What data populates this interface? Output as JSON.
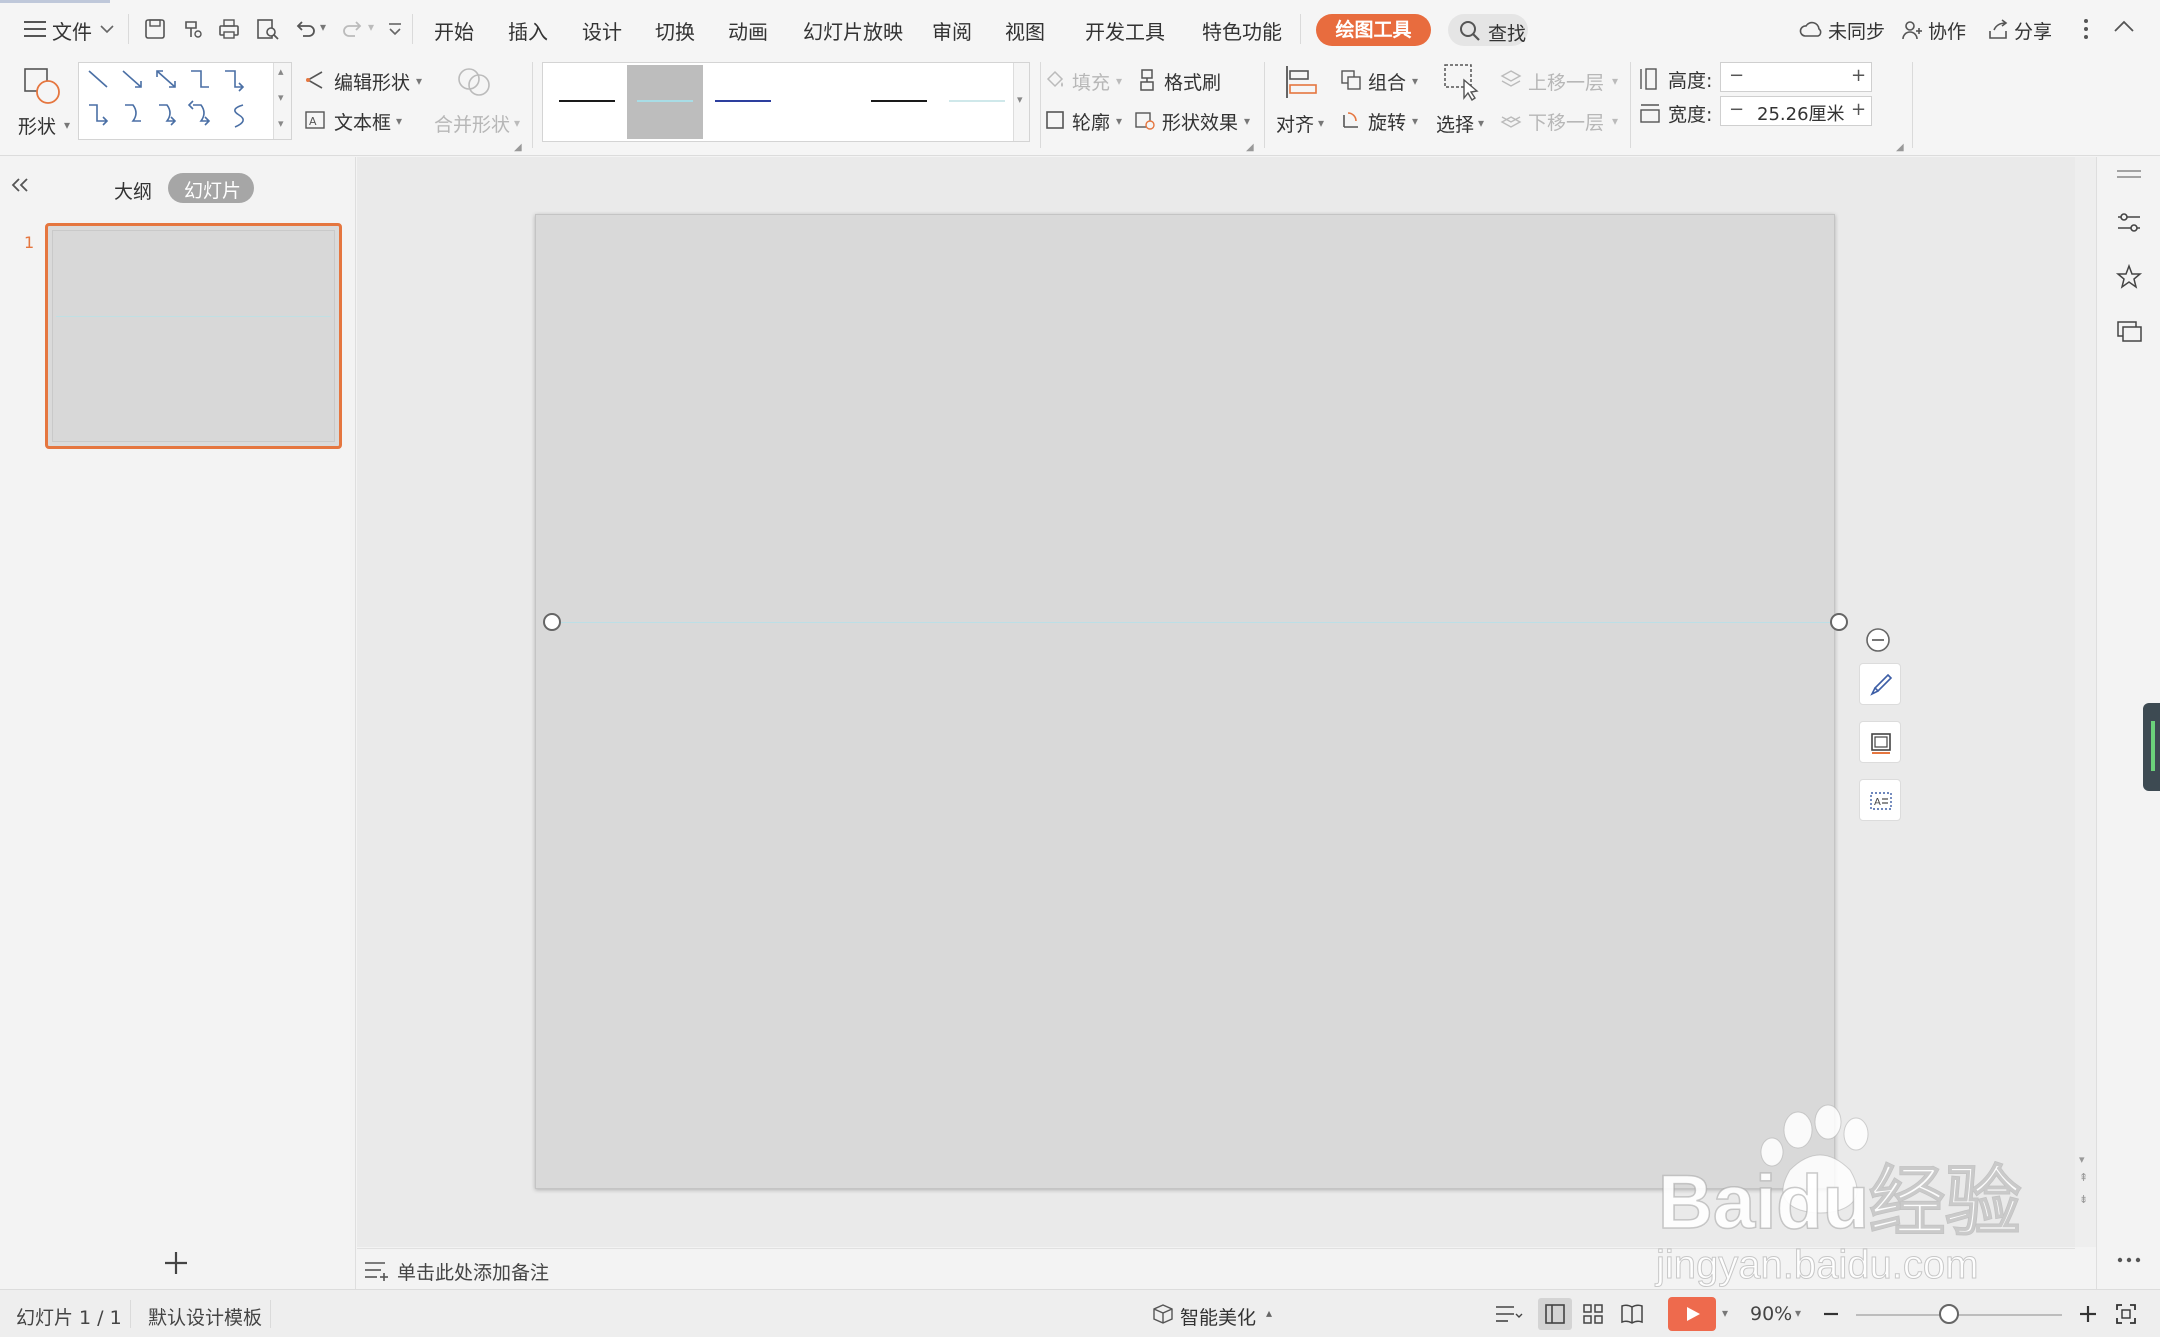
{
  "menu": {
    "file_label": "文件",
    "tabs": [
      "开始",
      "插入",
      "设计",
      "切换",
      "动画",
      "幻灯片放映",
      "审阅",
      "视图",
      "开发工具",
      "特色功能"
    ],
    "active_tab": "绘图工具",
    "search_label": "查找",
    "sync_label": "未同步",
    "collab_label": "协作",
    "share_label": "分享"
  },
  "ribbon": {
    "shape_label": "形状",
    "edit_shape_label": "编辑形状",
    "textbox_label": "文本框",
    "merge_shape_label": "合并形状",
    "fill_label": "填充",
    "format_painter_label": "格式刷",
    "outline_label": "轮廓",
    "shape_effect_label": "形状效果",
    "align_label": "对齐",
    "group_label": "组合",
    "rotate_label": "旋转",
    "select_label": "选择",
    "bring_forward_label": "上移一层",
    "send_backward_label": "下移一层",
    "height_label": "高度:",
    "height_value": "",
    "width_label": "宽度:",
    "width_value": "25.26厘米",
    "style_swatch_colors": [
      "#1a1a1a",
      "#a8dde6",
      "#2d3f9e",
      "#ffffff",
      "#1a1a1a",
      "#cfe8ea"
    ]
  },
  "left_panel": {
    "outline_tab": "大纲",
    "slides_tab": "幻灯片",
    "slide_number": "1"
  },
  "notes": {
    "placeholder": "单击此处添加备注"
  },
  "status": {
    "slide_counter": "幻灯片 1 / 1",
    "template_label": "默认设计模板",
    "smart_beautify_label": "智能美化",
    "zoom_label": "90%",
    "zoom_level": 0.45
  },
  "colors": {
    "accent": "#e86c3e",
    "slide_bg": "#d9d9d9",
    "line_color": "#bcdfe6"
  },
  "watermark": {
    "brand": "Baidu经验",
    "url": "jingyan.baidu.com"
  }
}
